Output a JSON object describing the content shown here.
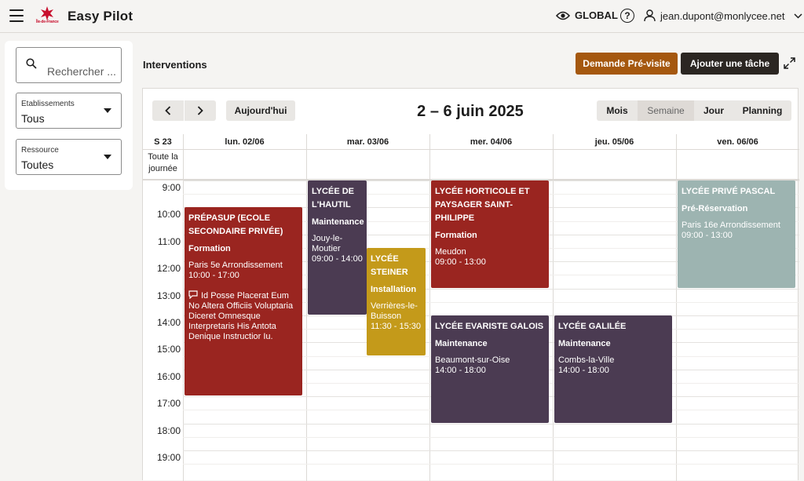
{
  "header": {
    "app_title": "Easy Pilot",
    "logo_text": "Île-de-France",
    "scope_label": "GLOBAL",
    "help_label": "?",
    "user_email": "jean.dupont@monlycee.net"
  },
  "sidebar": {
    "search_placeholder": "Rechercher ...",
    "filters": [
      {
        "label": "Etablissements",
        "value": "Tous"
      },
      {
        "label": "Ressource",
        "value": "Toutes"
      }
    ]
  },
  "page": {
    "title": "Interventions",
    "btn_previsite": "Demande Pré-visite",
    "btn_add_task": "Ajouter une tâche"
  },
  "calendar": {
    "today_label": "Aujourd'hui",
    "range_title": "2 – 6 juin 2025",
    "views": [
      "Mois",
      "Semaine",
      "Jour",
      "Planning"
    ],
    "active_view": "Semaine",
    "week_label": "S 23",
    "days": [
      "lun. 02/06",
      "mar. 03/06",
      "mer. 04/06",
      "jeu. 05/06",
      "ven. 06/06"
    ],
    "allday_label": "Toute la journée",
    "hours": [
      "9:00",
      "10:00",
      "11:00",
      "12:00",
      "13:00",
      "14:00",
      "15:00",
      "16:00",
      "17:00",
      "18:00",
      "19:00"
    ],
    "events": [
      {
        "title": "PRÉPASUP (ECOLE SECONDAIRE PRIVÉE)",
        "type": "Formation",
        "location": "Paris 5e Arrondissement",
        "time": "10:00 - 17:00",
        "note": "Id Posse Placerat Eum No Altera Officiis Voluptaria Diceret Omnesque Interpretaris His Antota Denique Instructior Iu."
      },
      {
        "title": "LYCÉE DE L'HAUTIL",
        "type": "Maintenance",
        "location": "Jouy-le-Moutier",
        "time": "09:00 - 14:00"
      },
      {
        "title": "LYCÉE STEINER",
        "type": "Installation",
        "location": "Verrières-le-Buisson",
        "time": "11:30 - 15:30"
      },
      {
        "title": "LYCÉE HORTICOLE ET PAYSAGER SAINT-PHILIPPE",
        "type": "Formation",
        "location": "Meudon",
        "time": "09:00 - 13:00"
      },
      {
        "title": "LYCÉE EVARISTE GALOIS",
        "type": "Maintenance",
        "location": "Beaumont-sur-Oise",
        "time": "14:00 - 18:00"
      },
      {
        "title": "LYCÉE GALILÉE",
        "type": "Maintenance",
        "location": "Combs-la-Ville",
        "time": "14:00 - 18:00"
      },
      {
        "title": "LYCÉE PRIVÉ PASCAL",
        "type": "Pré-Réservation",
        "location": "Paris 16e Arrondissement",
        "time": "09:00 - 13:00"
      }
    ]
  },
  "colors": {
    "formation": "#9a2520",
    "maintenance": "#4b3b52",
    "installation": "#c49a1a",
    "prereservation": "#9db4b1",
    "primary_button": "#a5580f",
    "dark_button": "#2b2622"
  },
  "icons": [
    "menu-icon",
    "eye-icon",
    "help-icon",
    "user-icon",
    "chevron-down-icon",
    "search-icon",
    "chevron-left-icon",
    "chevron-right-icon",
    "expand-icon",
    "comment-icon"
  ]
}
